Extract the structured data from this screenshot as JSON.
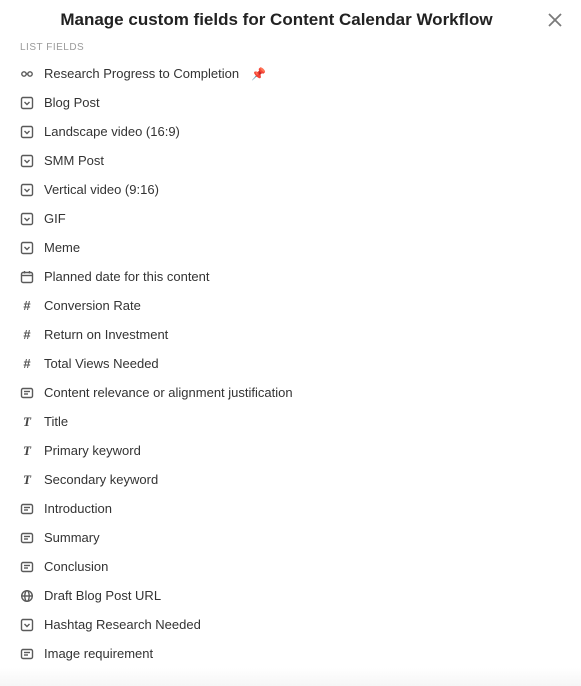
{
  "header": {
    "title": "Manage custom fields for Content Calendar Workflow"
  },
  "section_label": "LIST FIELDS",
  "fields": [
    {
      "label": "Research Progress to Completion",
      "icon": "progress",
      "pinned": true
    },
    {
      "label": "Blog Post",
      "icon": "dropdown",
      "pinned": false
    },
    {
      "label": "Landscape video (16:9)",
      "icon": "dropdown",
      "pinned": false
    },
    {
      "label": "SMM Post",
      "icon": "dropdown",
      "pinned": false
    },
    {
      "label": "Vertical video (9:16)",
      "icon": "dropdown",
      "pinned": false
    },
    {
      "label": "GIF",
      "icon": "dropdown",
      "pinned": false
    },
    {
      "label": "Meme",
      "icon": "dropdown",
      "pinned": false
    },
    {
      "label": "Planned date for this content",
      "icon": "date",
      "pinned": false
    },
    {
      "label": "Conversion Rate",
      "icon": "number",
      "pinned": false
    },
    {
      "label": "Return on Investment",
      "icon": "number",
      "pinned": false
    },
    {
      "label": "Total Views Needed",
      "icon": "number",
      "pinned": false
    },
    {
      "label": "Content relevance or alignment justification",
      "icon": "textarea",
      "pinned": false
    },
    {
      "label": "Title",
      "icon": "text",
      "pinned": false
    },
    {
      "label": "Primary keyword",
      "icon": "text",
      "pinned": false
    },
    {
      "label": "Secondary keyword",
      "icon": "text",
      "pinned": false
    },
    {
      "label": "Introduction",
      "icon": "textarea",
      "pinned": false
    },
    {
      "label": "Summary",
      "icon": "textarea",
      "pinned": false
    },
    {
      "label": "Conclusion",
      "icon": "textarea",
      "pinned": false
    },
    {
      "label": "Draft Blog Post URL",
      "icon": "url",
      "pinned": false
    },
    {
      "label": "Hashtag Research Needed",
      "icon": "dropdown",
      "pinned": false
    },
    {
      "label": "Image requirement",
      "icon": "textarea",
      "pinned": false
    }
  ]
}
